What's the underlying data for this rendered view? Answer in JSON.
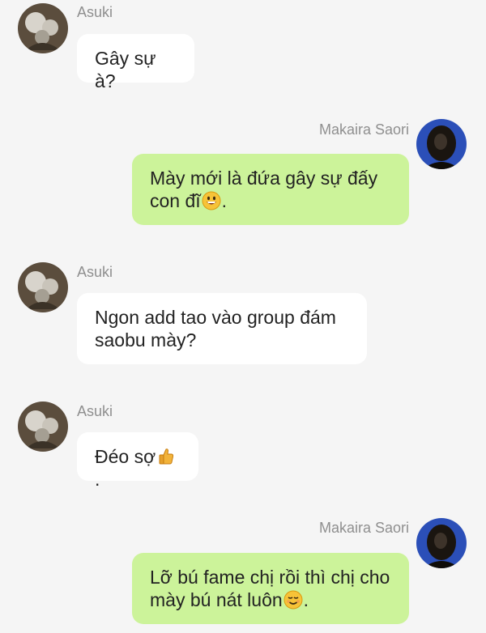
{
  "messages": [
    {
      "sender": "Asuki",
      "side": "incoming",
      "text": "Gây sự à?"
    },
    {
      "sender": "Makaira Saori",
      "side": "outgoing",
      "text": "Mày mới là đứa gây sự đấy con đĩ",
      "trailing_emoji": "grinning-face-emoji",
      "after": "."
    },
    {
      "sender": "Asuki",
      "side": "incoming",
      "text": "Ngon add tao vào group đám saobu mày?"
    },
    {
      "sender": "Asuki",
      "side": "incoming",
      "text": "Đéo sợ",
      "trailing_emoji": "thumbs-up-emoji",
      "after": "."
    },
    {
      "sender": "Makaira Saori",
      "side": "outgoing",
      "text": "Lỡ bú fame chị rồi thì chị cho mày bú nát luôn",
      "trailing_emoji": "relieved-smile-emoji",
      "after": "."
    }
  ],
  "colors": {
    "background": "#f5f5f5",
    "incoming_bubble": "#ffffff",
    "outgoing_bubble": "#ccf39a",
    "name_text": "#8f8f8f"
  }
}
